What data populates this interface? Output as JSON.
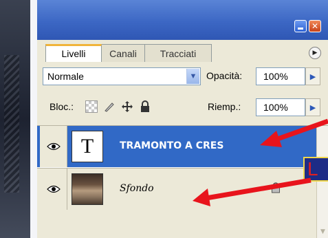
{
  "tabs": [
    {
      "label": "Livelli",
      "active": true
    },
    {
      "label": "Canali",
      "active": false
    },
    {
      "label": "Tracciati",
      "active": false
    }
  ],
  "blend": {
    "mode": "Normale",
    "opacity_label": "Opacità:",
    "opacity_value": "100%"
  },
  "lock_row": {
    "lock_label": "Bloc.:",
    "fill_label": "Riemp.:",
    "fill_value": "100%"
  },
  "layers": [
    {
      "name": "TRAMONTO A CRES",
      "thumb": "T",
      "selected": true
    },
    {
      "name": "Sfondo",
      "selected": false,
      "locked": true
    }
  ],
  "callout": {
    "text": "L"
  },
  "colors": {
    "selection": "#3169c6",
    "arrow": "#e8141c",
    "callout_bg": "#1e2c86",
    "palette": "#ece9d8"
  },
  "icons": [
    "eye-icon",
    "lock-icon",
    "brush-icon",
    "move-icon",
    "checker-icon"
  ]
}
